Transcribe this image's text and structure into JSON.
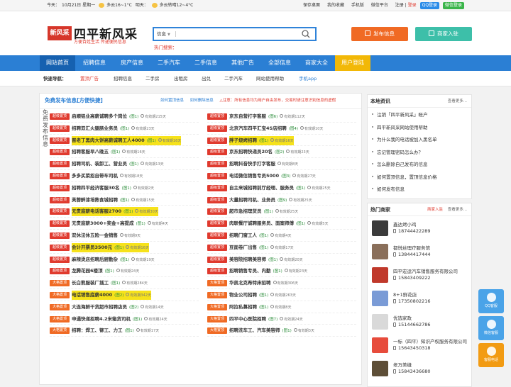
{
  "topbar": {
    "date_prefix": "今天：",
    "date": "10月21日 星期一",
    "weather_today": "多云16~1°C",
    "tomorrow_label": "明天：",
    "weather_tomorrow": "多云转晴12~4°C",
    "links": [
      "保存桌面",
      "我的收藏",
      "手机版",
      "微信平台"
    ],
    "register": "注册",
    "login": "登录",
    "qq_login": "QQ登录",
    "wx_login": "微信登录"
  },
  "header": {
    "logo_badge": "新风采",
    "logo_title": "四平新风采",
    "logo_sub": "方便百姓生活 传递便民信息",
    "search_category": "信息",
    "search_placeholder": "",
    "hot_label": "热门搜索：",
    "post_button": "发布信息",
    "join_button": "商家入驻"
  },
  "nav": [
    "网站首页",
    "招聘信息",
    "房产信息",
    "二手汽车",
    "二手信息",
    "其他广告",
    "全部信息",
    "商家大全",
    "用户登陆"
  ],
  "subnav": {
    "label": "快速导航：",
    "items": [
      "置顶广告",
      "招聘信息",
      "二手房",
      "出租房",
      "出兑",
      "二手汽车",
      "网站使用帮助",
      "手机app"
    ]
  },
  "panel": {
    "title": "免费发布信息[方便快捷]",
    "link1": "如何置顶信息",
    "link2": "如何删除信息",
    "warn": "△注意：所有信息均为用户自由发布，交易时请注意识别信息的虚假",
    "side_text": "免费发布信息",
    "left": [
      {
        "badge": "超级置顶",
        "title": "启顺铝业高薪诚聘多个岗位",
        "count": "(图1)",
        "exp": "有效期215天",
        "hl": false
      },
      {
        "badge": "超级置顶",
        "title": "招聘双汇火腿肠业务员",
        "count": "(图1)",
        "exp": "有效期23天",
        "hl": false
      },
      {
        "badge": "超级置顶",
        "title": "晋老丁黑肉大饼高薪诚聘工人4000",
        "count": "(图1)",
        "exp": "有效期16天",
        "hl": true
      },
      {
        "badge": "超级置顶",
        "title": "招聘客服早八晚五",
        "count": "(图1)",
        "exp": "有效期16天",
        "hl": false
      },
      {
        "badge": "超级置顶",
        "title": "招聘司机、装卸工、营业员",
        "count": "(图1)",
        "exp": "有效期13天",
        "hl": false
      },
      {
        "badge": "超级置顶",
        "title": "多多买菜招自带车司机",
        "count": "",
        "exp": "有效期18天",
        "hl": false
      },
      {
        "badge": "超级置顶",
        "title": "招聘四平经济客服30名",
        "count": "(图1)",
        "exp": "有效期2天",
        "hl": false
      },
      {
        "badge": "超级置顶",
        "title": "芙蓉醉漆培熟食城招聘",
        "count": "(图1)",
        "exp": "有效期15天",
        "hl": false
      },
      {
        "badge": "超级置顶",
        "title": "无责底薪电话客服2700",
        "count": "(图1)",
        "exp": "有效期30天",
        "hl": true
      },
      {
        "badge": "超级置顶",
        "title": "无责底薪3000+奖金+高提成",
        "count": "(图1)",
        "exp": "有效期4天",
        "hl": false
      },
      {
        "badge": "超级置顶",
        "title": "双休法休五险一金销售",
        "count": "",
        "exp": "有效期9天",
        "hl": false
      },
      {
        "badge": "超级置顶",
        "title": "会计开票员3500元",
        "count": "(图1)",
        "exp": "有效期16天",
        "hl": true
      },
      {
        "badge": "超级置顶",
        "title": "麻辣烫店招聘后厨勤杂",
        "count": "(图1)",
        "exp": "有效期19天",
        "hl": false
      },
      {
        "badge": "超级置顶",
        "title": "龙腾花园6楼顶",
        "count": "(图1)",
        "exp": "有效期24天",
        "hl": false
      },
      {
        "badge": "大格置顶",
        "title": "长白熊服装厂插工",
        "count": "(图1)",
        "exp": "有效期284天",
        "hl": false
      },
      {
        "badge": "大格置顶",
        "title": "电话销售底薪4000",
        "count": "(图2)",
        "exp": "有效期342天",
        "hl": true
      },
      {
        "badge": "大格置顶",
        "title": "大连海鲜干货超市招聘店员",
        "count": "(图2)",
        "exp": "有效期14天",
        "hl": false
      },
      {
        "badge": "大格置顶",
        "title": "申通快递招聘4.2米箱货司机",
        "count": "(图1)",
        "exp": "有效期24天",
        "hl": false
      },
      {
        "badge": "大格置顶",
        "title": "招聘：焊工、铆工、力工",
        "count": "(图1)",
        "exp": "有效期17天",
        "hl": false
      }
    ],
    "right": [
      {
        "badge": "超级置顶",
        "title": "京东自营打字客服",
        "count": "(图6)",
        "exp": "有效期112天",
        "hl": false
      },
      {
        "badge": "超级置顶",
        "title": "北京汽车四平汇宝4S店招聘",
        "count": "(图4)",
        "exp": "有效期10天",
        "hl": false
      },
      {
        "badge": "超级置顶",
        "title": "胖子烧烤招聘",
        "count": "(图1)",
        "exp": "有效期16天",
        "hl": true
      },
      {
        "badge": "超级置顶",
        "title": "京东招聘快递员20名",
        "count": "(图2)",
        "exp": "有效期23天",
        "hl": false
      },
      {
        "badge": "超级置顶",
        "title": "招聘抖音快手打字客服",
        "count": "",
        "exp": "有效期8天",
        "hl": false
      },
      {
        "badge": "超级置顶",
        "title": "电话微信销售专员5000",
        "count": "(图3)",
        "exp": "有效期27天",
        "hl": false
      },
      {
        "badge": "超级置顶",
        "title": "自主来城招聘前厅经理、服务员",
        "count": "(图1)",
        "exp": "有效期25天",
        "hl": false
      },
      {
        "badge": "超级置顶",
        "title": "大量招聘司机、业务员",
        "count": "(图9)",
        "exp": "有效期25天",
        "hl": false
      },
      {
        "badge": "超级置顶",
        "title": "超市急招理货员",
        "count": "(图1)",
        "exp": "有效期25天",
        "hl": false
      },
      {
        "badge": "超级置顶",
        "title": "肉联餐厅诚聘服务员、面案师傅",
        "count": "(图1)",
        "exp": "有效期5天",
        "hl": false
      },
      {
        "badge": "超级置顶",
        "title": "招聘门窗工人",
        "count": "(图1)",
        "exp": "有效期4天",
        "hl": false
      },
      {
        "badge": "超级置顶",
        "title": "豆面卷厂出售",
        "count": "(图1)",
        "exp": "有效期17天",
        "hl": false
      },
      {
        "badge": "超级置顶",
        "title": "美容院招聘美容师",
        "count": "(图1)",
        "exp": "有效期20天",
        "hl": false
      },
      {
        "badge": "超级置顶",
        "title": "招聘销售专员、内勤",
        "count": "(图1)",
        "exp": "有效期23天",
        "hl": false
      },
      {
        "badge": "大格置顶",
        "title": "华凯北克希特床招聘",
        "count": "",
        "exp": "有效期306天",
        "hl": false
      },
      {
        "badge": "大格置顶",
        "title": "物业公司招聘",
        "count": "(图1)",
        "exp": "有效期263天",
        "hl": false
      },
      {
        "badge": "大格置顶",
        "title": "阿拉私募招聘",
        "count": "(图1)",
        "exp": "有效期8天",
        "hl": false
      },
      {
        "badge": "大格置顶",
        "title": "四平中心医院招聘",
        "count": "(图7)",
        "exp": "有效期24天",
        "hl": false
      },
      {
        "badge": "大格置顶",
        "title": "招聘洗车工、汽车美容师",
        "count": "(图1)",
        "exp": "有效期3天",
        "hl": false
      }
    ]
  },
  "news": {
    "title": "本地资讯",
    "more": "查看更多...",
    "items": [
      "注销「四平新风采」帐户",
      "四平新风采网站使用帮助",
      "为什么我的电话被加入黑名单",
      "忘记管理密码怎么办？",
      "怎么删除自己发布的信息",
      "如何置顶信息，置顶信息价格",
      "如何发布信息"
    ]
  },
  "shops": {
    "title": "热门商家",
    "join": "商家入驻",
    "more": "查看更多...",
    "items": [
      {
        "name": "鑫达烤小鸡",
        "phone": "18744422289"
      },
      {
        "name": "都悦丝理疗服务馆",
        "phone": "13844417444"
      },
      {
        "name": "四平宏运汽车销售服务有限公司",
        "phone": "15843409222"
      },
      {
        "name": "8+1鲜花店",
        "phone": "17350802216"
      },
      {
        "name": "优选家政",
        "phone": "15144662786"
      },
      {
        "name": "一标（四平）知识产权服务有限公司",
        "phone": "15643450318"
      },
      {
        "name": "老万美缝",
        "phone": "15843436680"
      }
    ]
  },
  "float": {
    "qq": "QQ客服",
    "wx": "微信客服",
    "tel": "客服电话"
  },
  "colors": {
    "brand_blue": "#2b7fd4",
    "accent_red": "#e03a2e",
    "orange": "#f06a24",
    "teal": "#3dbfa9",
    "highlight_yellow": "#f6e21b"
  }
}
